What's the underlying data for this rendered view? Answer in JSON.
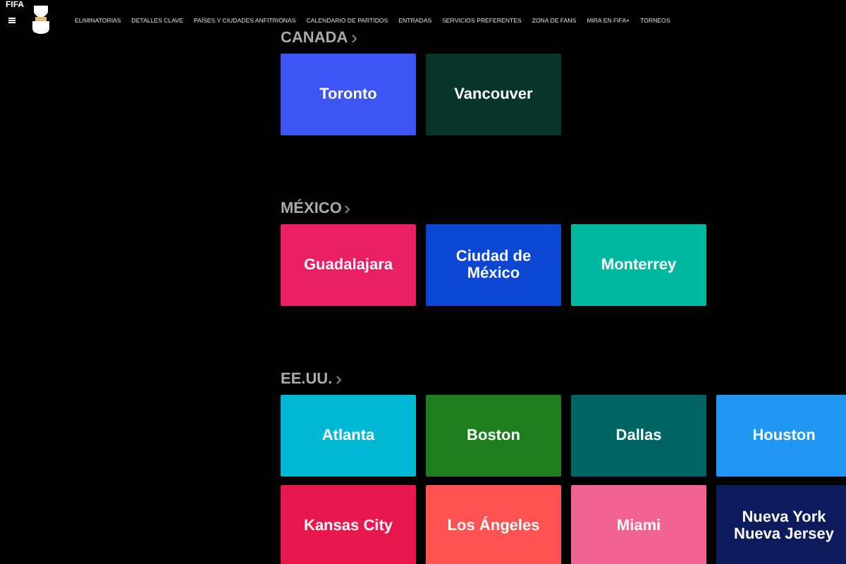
{
  "brand": "FIFA",
  "nav": [
    "ELIMINATORIAS",
    "DETALLES CLAVE",
    "PAÍSES Y CIUDADES ANFITRIONAS",
    "CALENDARIO DE PARTIDOS",
    "ENTRADAS",
    "SERVICIOS PREFERENTES",
    "ZONA DE FANS",
    "MIRA EN FIFA+",
    "TORNEOS"
  ],
  "sections": [
    {
      "title": "CANADA",
      "cities": [
        {
          "name": "Toronto",
          "color": "#3d55f5"
        },
        {
          "name": "Vancouver",
          "color": "#073529"
        }
      ]
    },
    {
      "title": "MÉXICO",
      "cities": [
        {
          "name": "Guadalajara",
          "color": "#e81f63"
        },
        {
          "name": "Ciudad de México",
          "color": "#0b47d3"
        },
        {
          "name": "Monterrey",
          "color": "#00b8a0"
        }
      ]
    },
    {
      "title": "EE.UU.",
      "cities": [
        {
          "name": "Atlanta",
          "color": "#00b8d4"
        },
        {
          "name": "Boston",
          "color": "#1e7d1f"
        },
        {
          "name": "Dallas",
          "color": "#006462"
        },
        {
          "name": "Houston",
          "color": "#2196f3"
        },
        {
          "name": "Kansas City",
          "color": "#e8174d"
        },
        {
          "name": "Los Ángeles",
          "color": "#ff5252"
        },
        {
          "name": "Miami",
          "color": "#f06292"
        },
        {
          "name": "Nueva York Nueva Jersey",
          "color": "#0d1a5b"
        }
      ]
    }
  ]
}
